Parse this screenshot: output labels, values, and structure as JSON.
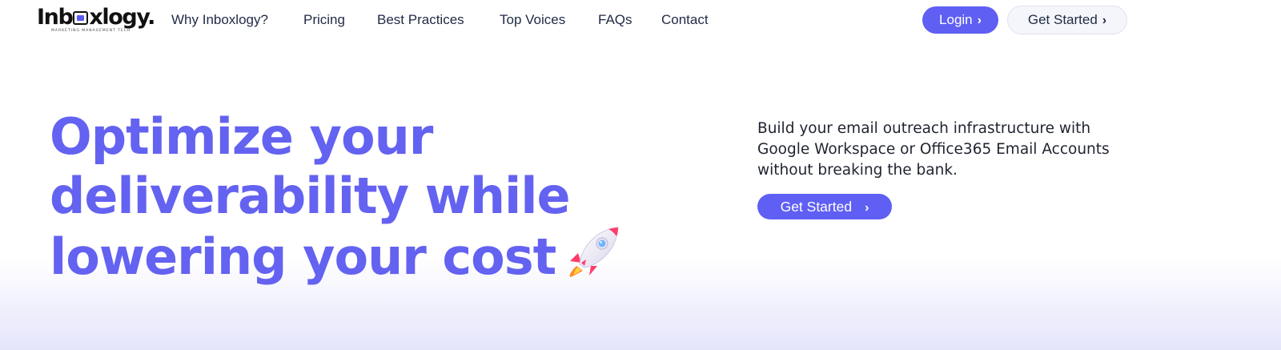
{
  "header": {
    "logo_text_pre": "Inb",
    "logo_text_post": "xlogy.",
    "logo_tagline": "MARKETING MANAGEMENT TECH",
    "nav": [
      {
        "label": "Why Inboxlogy?"
      },
      {
        "label": "Pricing"
      },
      {
        "label": "Best Practices"
      },
      {
        "label": "Top Voices"
      },
      {
        "label": "FAQs"
      },
      {
        "label": "Contact"
      }
    ],
    "login_label": "Login",
    "get_started_label": "Get Started"
  },
  "hero": {
    "title_lines": [
      "Optimize your",
      "deliverability while",
      "lowering your cost"
    ],
    "description": "Build your email outreach infrastructure with Google Workspace or Office365 Email Accounts without breaking the bank.",
    "cta_label": "Get Started",
    "emoji_icon": "rocket-icon"
  },
  "colors": {
    "accent": "#6462f1",
    "button": "#5f5ff4",
    "text_dark": "#1f2a44",
    "gradient_bottom": "#e4e5fa"
  }
}
